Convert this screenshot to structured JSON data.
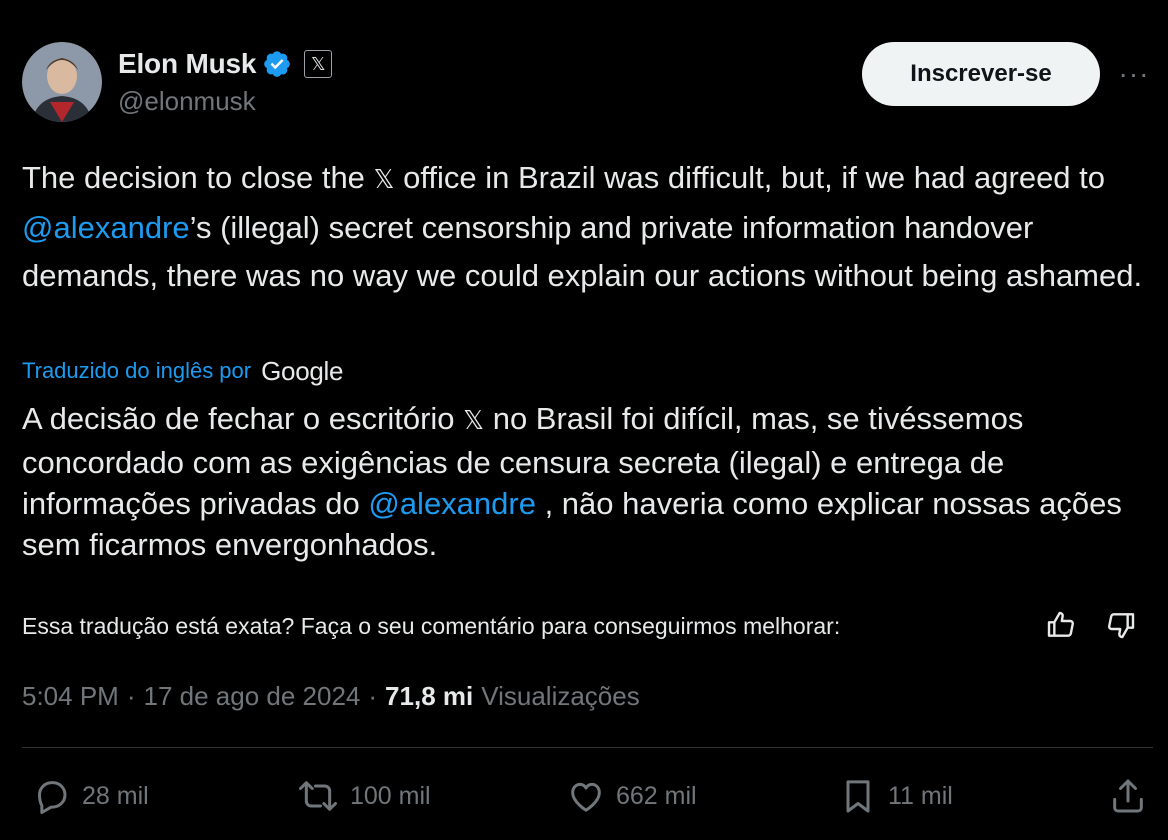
{
  "author": {
    "name": "Elon Musk",
    "handle": "@elonmusk",
    "affiliation_glyph": "𝕏"
  },
  "header": {
    "subscribe_label": "Inscrever-se",
    "more_label": "···"
  },
  "tweet": {
    "text_part1": "The decision to close the ",
    "x_glyph": "𝕏",
    "text_part2": " office in Brazil was difficult, but, if we had agreed to ",
    "mention": "@alexandre",
    "text_part3": "’s (illegal) secret censorship and private information handover demands, there was no way we could explain our actions without being ashamed."
  },
  "translation": {
    "label": "Traduzido do inglês por",
    "provider": "Google",
    "text_part1": "A decisão de fechar o escritório ",
    "x_glyph": "𝕏",
    "text_part2": " no Brasil foi difícil, mas, se tivéssemos concordado com as exigências de censura secreta (ilegal) e entrega de informações privadas do ",
    "mention": "@alexandre",
    "text_part3": " , não haveria como explicar nossas ações sem ficarmos envergonhados.",
    "feedback_prompt": "Essa tradução está exata? Faça o seu comentário para conseguirmos melhorar:"
  },
  "meta": {
    "time": "5:04 PM",
    "separator": "·",
    "date": "17 de ago de 2024",
    "views_count": "71,8 mi",
    "views_label": "Visualizações"
  },
  "actions": {
    "replies": "28 mil",
    "reposts": "100 mil",
    "likes": "662 mil",
    "bookmarks": "11 mil"
  },
  "colors": {
    "background": "#000000",
    "text": "#e7e9ea",
    "muted": "#71767b",
    "accent": "#1d9bf0",
    "verified": "#1d9bf0",
    "button_bg": "#eff3f4",
    "divider": "#2f3336"
  },
  "icons": {
    "verified": "verified-badge-icon",
    "affiliation": "x-logo-icon",
    "more": "more-dots-icon",
    "thumb_up": "thumbs-up-icon",
    "thumb_down": "thumbs-down-icon",
    "reply": "reply-icon",
    "repost": "repost-icon",
    "like": "heart-icon",
    "bookmark": "bookmark-icon",
    "share": "share-icon"
  }
}
